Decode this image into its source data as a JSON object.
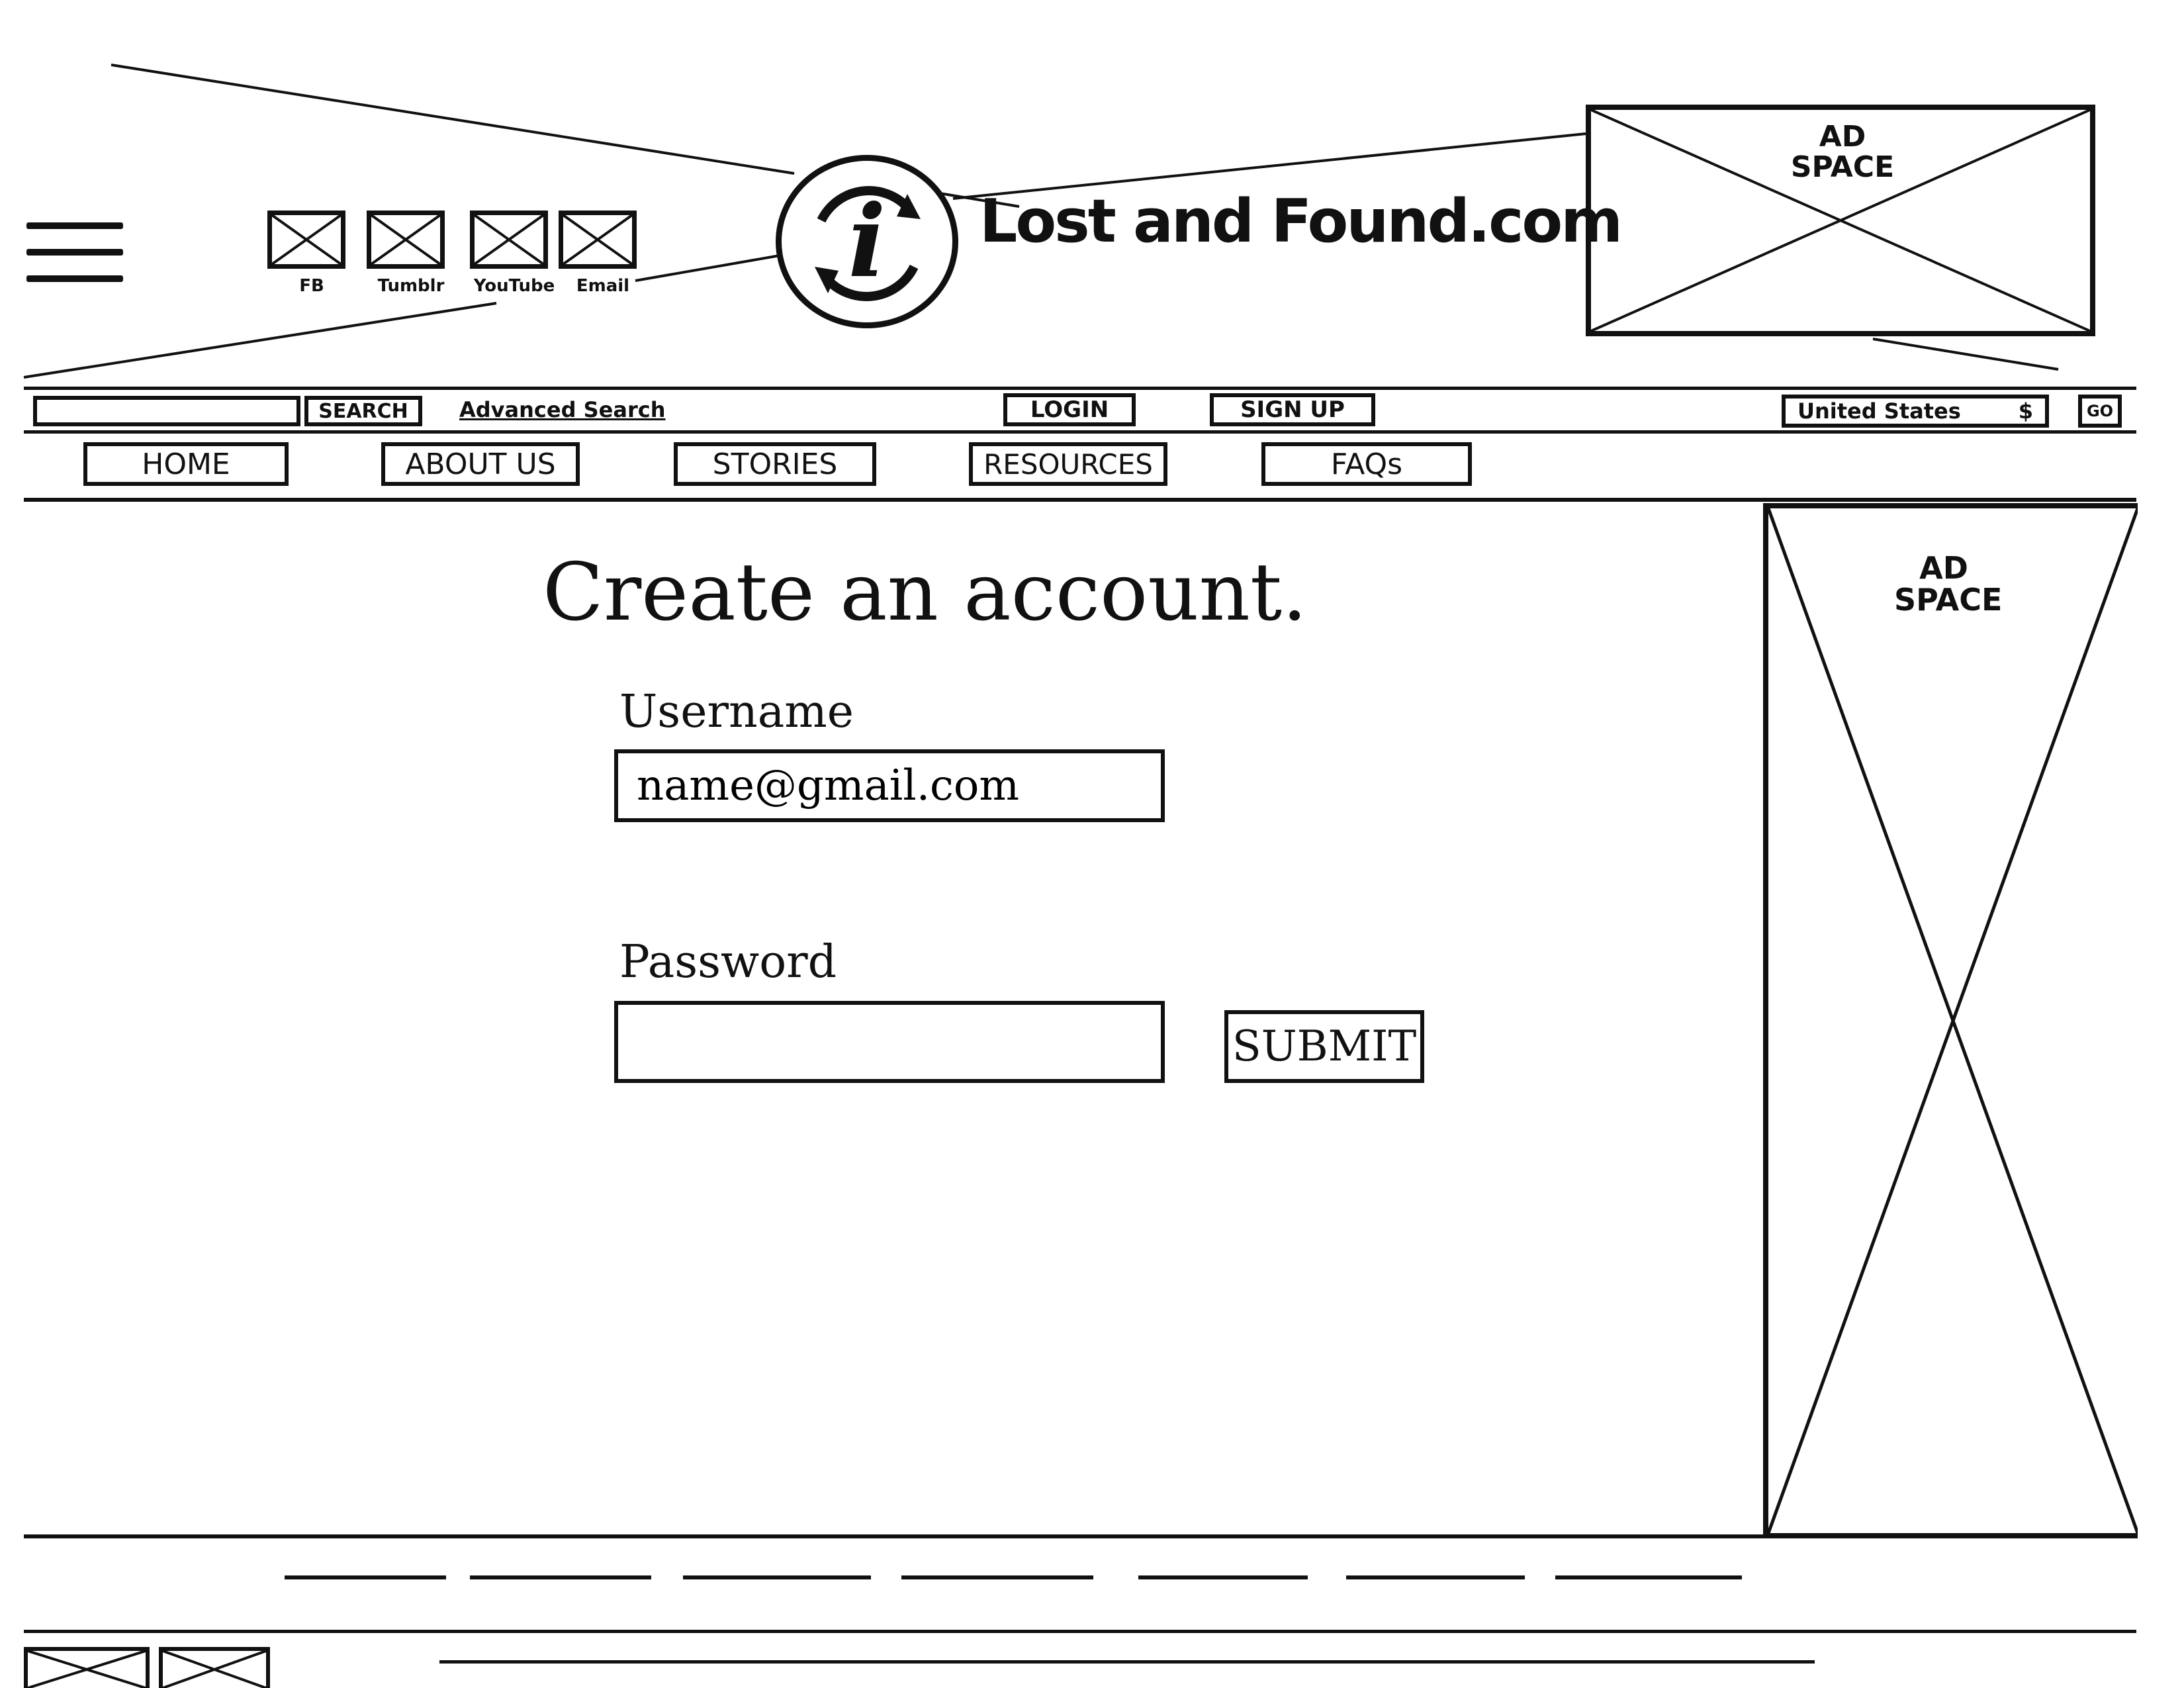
{
  "header": {
    "social_links": [
      {
        "label": "FB",
        "icon": "facebook-icon"
      },
      {
        "label": "Tumblr",
        "icon": "tumblr-icon"
      },
      {
        "label": "YouTube",
        "icon": "youtube-icon"
      },
      {
        "label": "Email",
        "icon": "email-icon"
      }
    ],
    "logo_glyph": "i",
    "site_title": "Lost and Found.com",
    "ad_top": {
      "line1": "AD",
      "line2": "SPACE"
    }
  },
  "utility_bar": {
    "search_value": "",
    "search_button": "SEARCH",
    "advanced_search": "Advanced Search",
    "login": "LOGIN",
    "signup": "SIGN UP",
    "country_selected": "United States",
    "country_arrow": "$",
    "go": "GO"
  },
  "nav": {
    "items": [
      "HOME",
      "ABOUT US",
      "STORIES",
      "RESOURCES",
      "FAQs"
    ]
  },
  "form": {
    "title": "Create an account.",
    "username_label": "Username",
    "username_value": "name@gmail.com",
    "password_label": "Password",
    "password_value": "",
    "submit_label": "SUBMIT"
  },
  "sidebar_ad": {
    "line1": "AD",
    "line2": "SPACE"
  }
}
